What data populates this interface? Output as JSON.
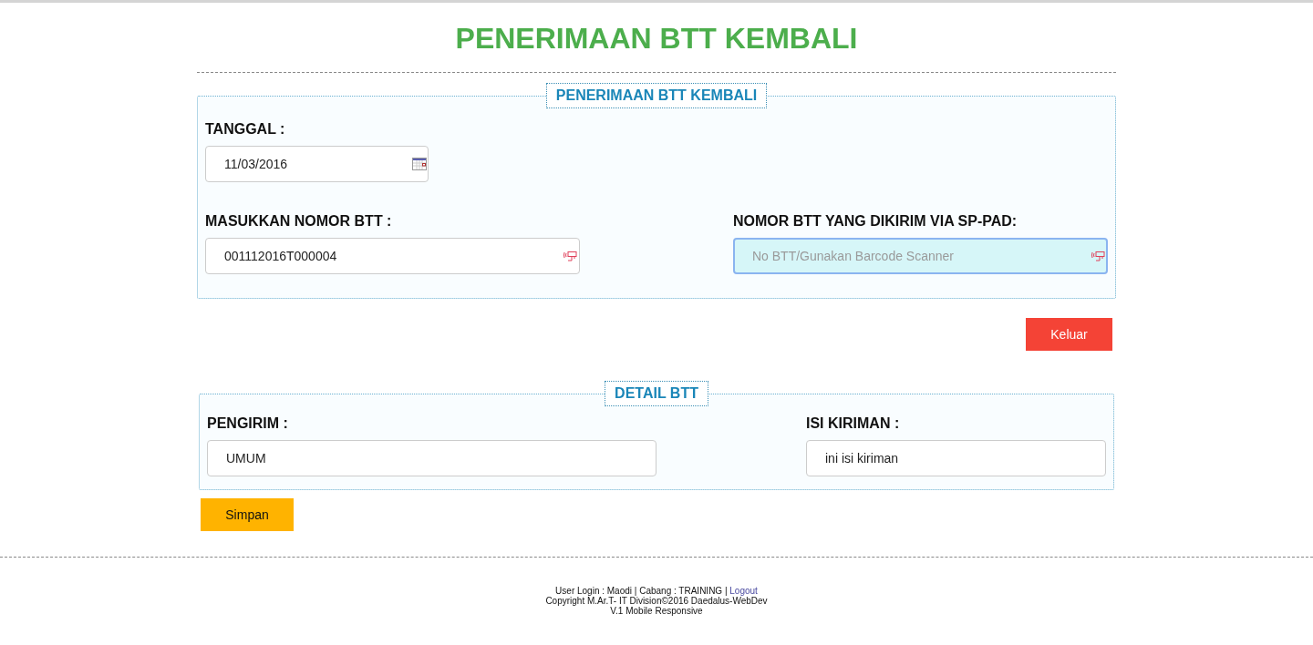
{
  "page_title": "PENERIMAAN BTT KEMBALI",
  "sections": [
    {
      "legend": "PENERIMAAN BTT KEMBALI",
      "rows": [
        [
          {
            "label": "TANGGAL :",
            "kind": "date",
            "value": "11/03/2016",
            "focused": false
          }
        ],
        [
          {
            "label": "MASUKKAN NOMOR BTT :",
            "kind": "scan",
            "value": "001112016T000004",
            "focused": false
          },
          {
            "label": "NOMOR BTT YANG DIKIRIM VIA SP-PAD:",
            "kind": "scan",
            "placeholder": "No BTT/Gunakan Barcode Scanner",
            "focused": true
          }
        ]
      ],
      "button": {
        "label": "Keluar",
        "kind": "danger"
      }
    },
    {
      "legend": "DETAIL BTT",
      "rows": [
        [
          {
            "label": "PENGIRIM :",
            "kind": "text",
            "value": "UMUM",
            "focused": false
          },
          {
            "label": "ISI KIRIMAN :",
            "kind": "text",
            "value": "ini isi kiriman",
            "focused": false
          }
        ]
      ],
      "button": {
        "label": "Simpan",
        "kind": "warning"
      }
    }
  ],
  "footer": {
    "login_info": "User Login : Maodi | Cabang : TRAINING |",
    "logout_link": "Logout",
    "copyright": "Copyright M.Ar.T- IT Division©2016 Daedalus-WebDev",
    "version": "V.1 Mobile Responsive"
  }
}
